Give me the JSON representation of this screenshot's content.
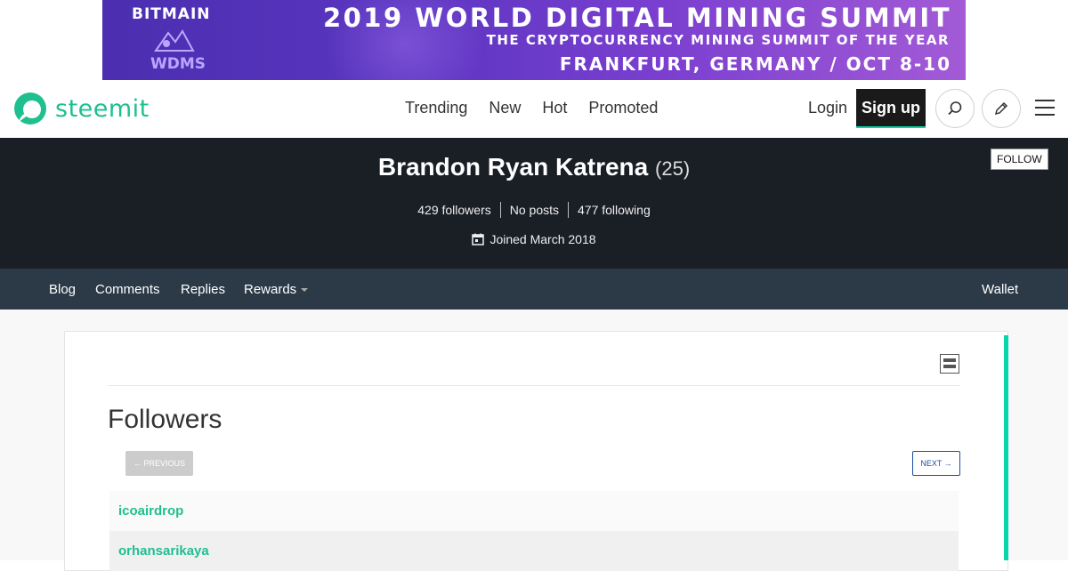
{
  "banner": {
    "brand": "BITMAIN",
    "event_short": "WDMS",
    "headline": "2019 WORLD DIGITAL MINING SUMMIT",
    "subheadline": "THE CRYPTOCURRENCY MINING SUMMIT OF THE YEAR",
    "location_date": "FRANKFURT, GERMANY / OCT 8-10"
  },
  "header": {
    "logo_text": "steemit",
    "nav": [
      "Trending",
      "New",
      "Hot",
      "Promoted"
    ],
    "login": "Login",
    "signup": "Sign up",
    "icons": [
      "search-icon",
      "pencil-icon",
      "hamburger-menu-icon"
    ]
  },
  "profile": {
    "name": "Brandon Ryan Katrena",
    "reputation": "(25)",
    "follow_label": "FOLLOW",
    "followers": "429 followers",
    "posts": "No posts",
    "following": "477 following",
    "joined": "Joined March 2018"
  },
  "subnav": {
    "blog": "Blog",
    "comments": "Comments",
    "replies": "Replies",
    "rewards": "Rewards",
    "wallet": "Wallet"
  },
  "followers_panel": {
    "title": "Followers",
    "prev": "← PREVIOUS",
    "next": "NEXT →",
    "list": [
      "icoairdrop",
      "orhansarikaya"
    ]
  },
  "colors": {
    "accent": "#06d6a9",
    "brand_green": "#1fbf8f",
    "profile_bg": "#1a1f26",
    "subnav_bg": "#2c3a47"
  }
}
